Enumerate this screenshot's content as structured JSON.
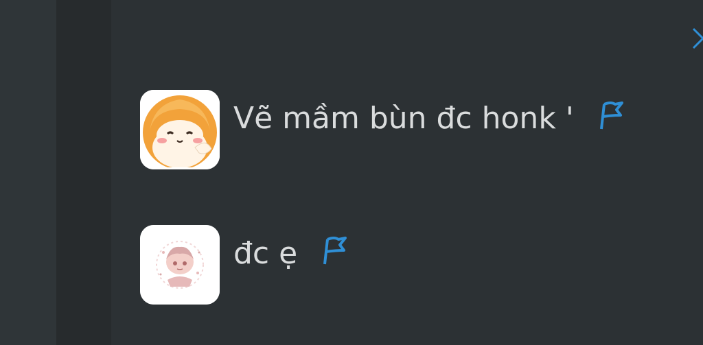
{
  "colors": {
    "background": "#2c3134",
    "rail": "#272b2d",
    "text": "#dadcdd",
    "accent": "#2f8fd6"
  },
  "panel": {
    "collapse_icon": "chevron-right-icon"
  },
  "comments": [
    {
      "avatar_icon": "shiba-dog-avatar",
      "text": "Vẽ mầm bùn đc honk '",
      "flag_icon": "flag-icon"
    },
    {
      "avatar_icon": "anime-girl-avatar",
      "text": "đc ẹ",
      "flag_icon": "flag-icon"
    }
  ]
}
